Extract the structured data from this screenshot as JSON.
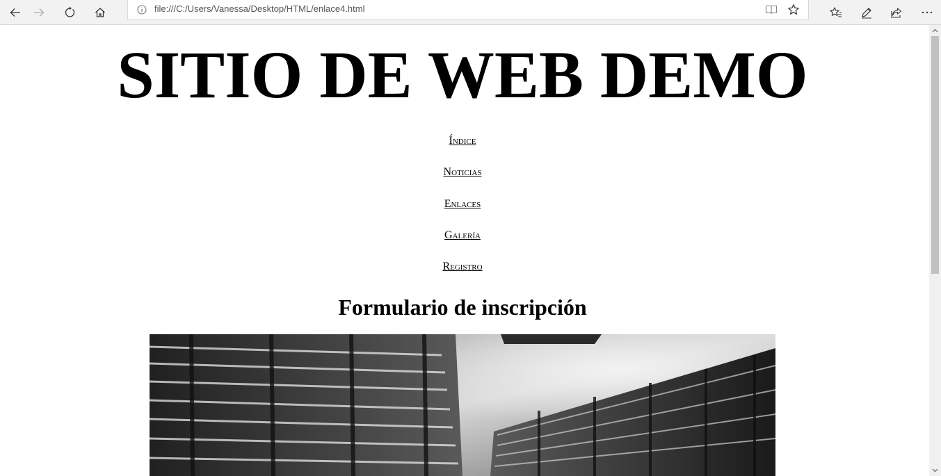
{
  "browser": {
    "url": "file:///C:/Users/Vanessa/Desktop/HTML/enlace4.html",
    "nav_icons": [
      "back-arrow-icon",
      "forward-arrow-icon",
      "refresh-icon",
      "home-icon"
    ],
    "right_icons": [
      "favorites-icon",
      "pen-icon",
      "share-icon",
      "more-icon"
    ]
  },
  "page": {
    "title": "SITIO DE WEB DEMO",
    "nav": [
      {
        "label": "Índice"
      },
      {
        "label": "Noticias"
      },
      {
        "label": "Enlaces"
      },
      {
        "label": "Galería"
      },
      {
        "label": "Registro"
      }
    ],
    "section_title": "Formulario de inscripción"
  },
  "colors": {
    "text": "#000000",
    "chrome_bg": "#f2f2f2",
    "scrollbar_thumb": "#c1c1c1"
  }
}
